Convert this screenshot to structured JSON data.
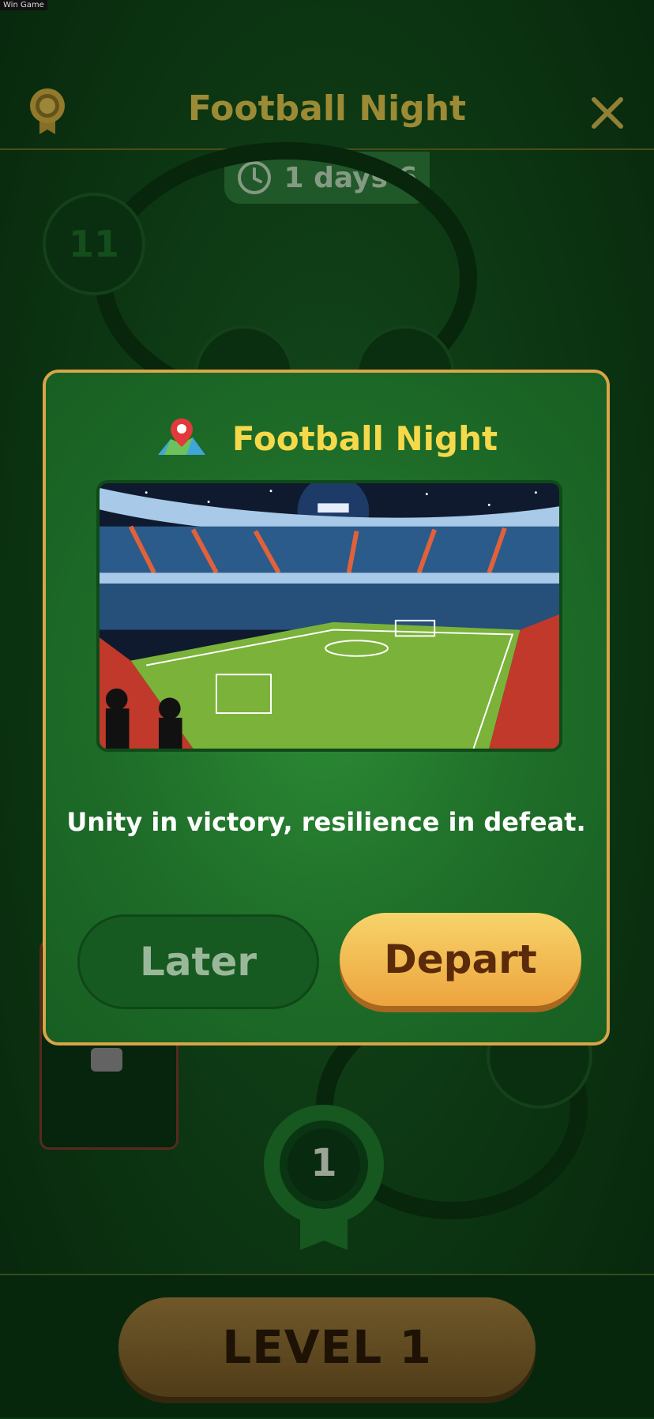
{
  "window": {
    "label": "Win Game"
  },
  "header": {
    "title": "Football Night"
  },
  "timer": {
    "text": "1 days 6"
  },
  "map": {
    "nodes": [
      {
        "label": "11"
      }
    ],
    "current_level": "1"
  },
  "bottom": {
    "level_button_label": "LEVEL 1"
  },
  "dialog": {
    "title": "Football Night",
    "quote": "Unity in victory, resilience in defeat.",
    "later_label": "Later",
    "depart_label": "Depart"
  },
  "colors": {
    "accent_gold": "#f6d94a",
    "dialog_border": "#d8a548",
    "depart_button": "#eda43e",
    "background_green": "#13501c"
  },
  "icons": [
    "medal-icon",
    "close-icon",
    "clock-icon",
    "map-pin-icon",
    "lock-icon"
  ]
}
